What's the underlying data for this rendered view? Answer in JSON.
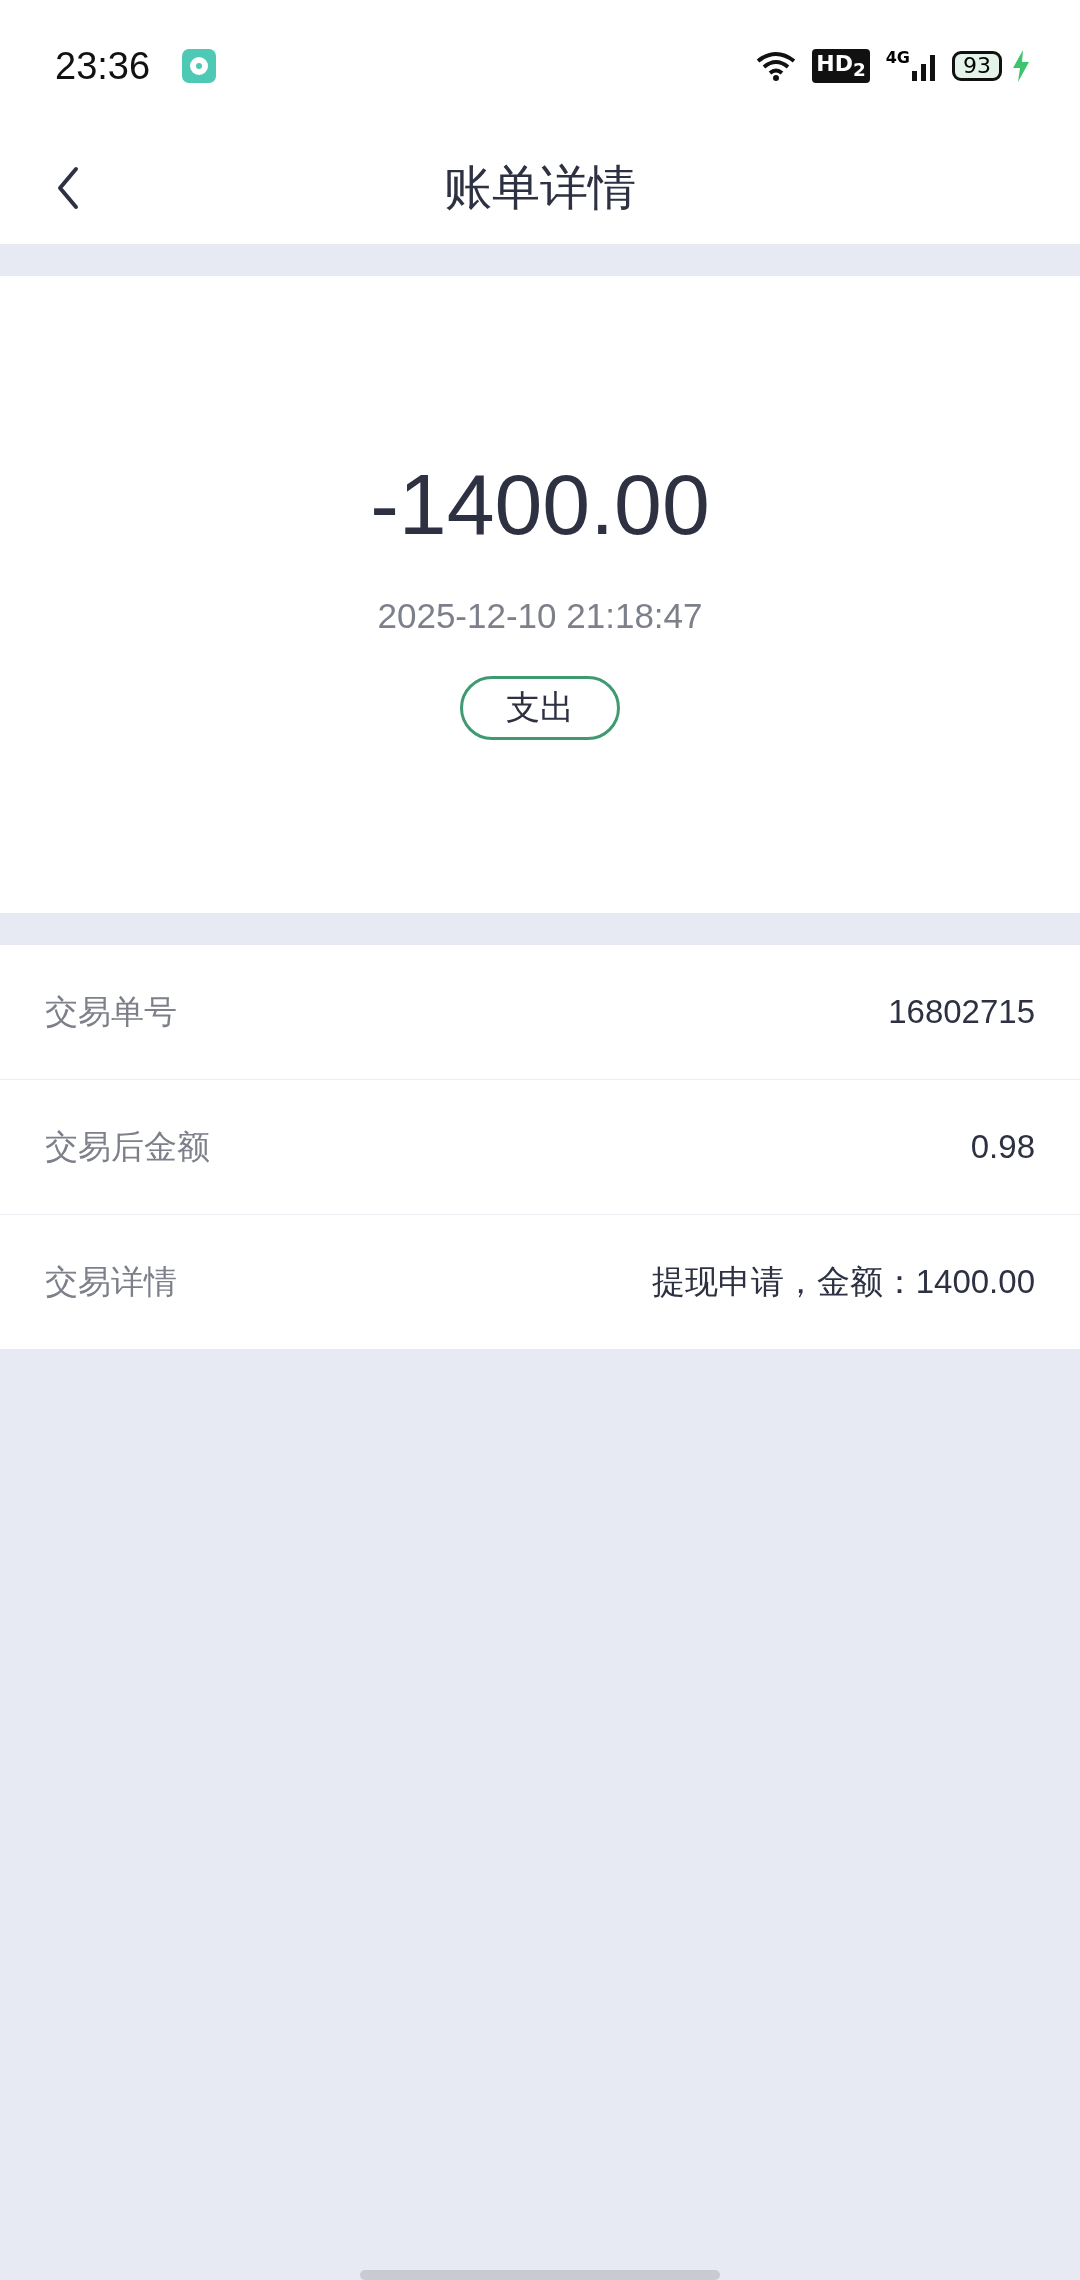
{
  "status_bar": {
    "time": "23:36",
    "network_badge": "HD$_{2}$",
    "network_type": "4G",
    "battery": "93"
  },
  "header": {
    "title": "账单详情"
  },
  "summary": {
    "amount": "-1400.00",
    "datetime": "2025-12-10 21:18:47",
    "type_tag": "支出"
  },
  "details": [
    {
      "label": "交易单号",
      "value": "16802715"
    },
    {
      "label": "交易后金额",
      "value": "0.98"
    },
    {
      "label": "交易详情",
      "value": "提现申请，金额：1400.00"
    }
  ]
}
